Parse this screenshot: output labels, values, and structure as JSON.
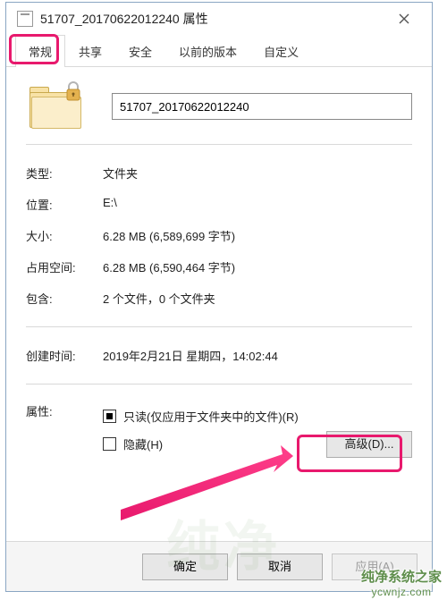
{
  "titlebar": {
    "title": "51707_20170622012240 属性"
  },
  "tabs": {
    "general": "常规",
    "share": "共享",
    "security": "安全",
    "previous": "以前的版本",
    "custom": "自定义"
  },
  "name_value": "51707_20170622012240",
  "kv": {
    "type_label": "类型:",
    "type_value": "文件夹",
    "location_label": "位置:",
    "location_value": "E:\\",
    "size_label": "大小:",
    "size_value": "6.28 MB (6,589,699 字节)",
    "ondisk_label": "占用空间:",
    "ondisk_value": "6.28 MB (6,590,464 字节)",
    "contains_label": "包含:",
    "contains_value": "2 个文件，0 个文件夹",
    "created_label": "创建时间:",
    "created_value": "2019年2月21日 星期四，14:02:44",
    "attrs_label": "属性:"
  },
  "attrs": {
    "readonly": "只读(仅应用于文件夹中的文件)(R)",
    "hidden": "隐藏(H)",
    "advanced": "高级(D)..."
  },
  "footer": {
    "ok": "确定",
    "cancel": "取消",
    "apply": "应用(A)"
  },
  "watermark": {
    "name": "纯净系统之家",
    "url": "ycwnjz.com"
  }
}
